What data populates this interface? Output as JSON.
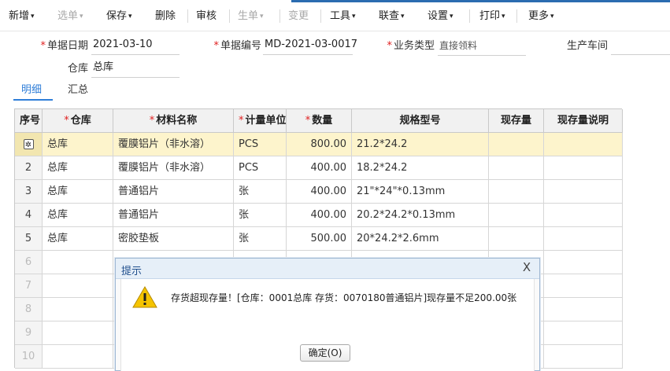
{
  "toolbar": {
    "items": [
      {
        "label": "新增",
        "caret": true,
        "disabled": false
      },
      {
        "label": "选单",
        "caret": true,
        "disabled": true
      },
      {
        "label": "保存",
        "caret": true,
        "disabled": false
      },
      {
        "label": "删除",
        "caret": false,
        "disabled": false
      },
      {
        "label": "审核",
        "caret": false,
        "disabled": false
      },
      {
        "label": "生单",
        "caret": true,
        "disabled": true
      },
      {
        "label": "变更",
        "caret": false,
        "disabled": true
      },
      {
        "label": "工具",
        "caret": true,
        "disabled": false
      },
      {
        "label": "联查",
        "caret": true,
        "disabled": false
      },
      {
        "label": "设置",
        "caret": true,
        "disabled": false
      },
      {
        "label": "打印",
        "caret": true,
        "disabled": false
      },
      {
        "label": "更多",
        "caret": true,
        "disabled": false
      }
    ],
    "caret_glyph": "▾"
  },
  "form": {
    "date_label": "单据日期",
    "date_value": "2021-03-10",
    "docno_label": "单据编号",
    "docno_value": "MD-2021-03-0017",
    "biztype_label": "业务类型",
    "biztype_value": "直接领料",
    "workshop_label": "生产车间",
    "workshop_value": "",
    "warehouse_label": "仓库",
    "warehouse_value": "总库"
  },
  "tabs": [
    {
      "label": "明细",
      "active": true
    },
    {
      "label": "汇总",
      "active": false
    }
  ],
  "grid": {
    "headers": [
      {
        "label": "序号",
        "required": false
      },
      {
        "label": "仓库",
        "required": true
      },
      {
        "label": "材料名称",
        "required": true
      },
      {
        "label": "计量单位",
        "required": true
      },
      {
        "label": "数量",
        "required": true
      },
      {
        "label": "规格型号",
        "required": false
      },
      {
        "label": "现存量",
        "required": false
      },
      {
        "label": "现存量说明",
        "required": false
      }
    ],
    "rows": [
      {
        "no": "",
        "warehouse": "总库",
        "material": "覆膜铝片（非水溶）",
        "unit": "PCS",
        "qty": "800.00",
        "spec": "21.2*24.2",
        "stock": "",
        "stock_note": "",
        "selected": true
      },
      {
        "no": "2",
        "warehouse": "总库",
        "material": "覆膜铝片（非水溶）",
        "unit": "PCS",
        "qty": "400.00",
        "spec": "18.2*24.2",
        "stock": "",
        "stock_note": "",
        "selected": false
      },
      {
        "no": "3",
        "warehouse": "总库",
        "material": "普通铝片",
        "unit": "张",
        "qty": "400.00",
        "spec": "21\"*24\"*0.13mm",
        "stock": "",
        "stock_note": "",
        "selected": false
      },
      {
        "no": "4",
        "warehouse": "总库",
        "material": "普通铝片",
        "unit": "张",
        "qty": "400.00",
        "spec": "20.2*24.2*0.13mm",
        "stock": "",
        "stock_note": "",
        "selected": false
      },
      {
        "no": "5",
        "warehouse": "总库",
        "material": "密胶垫板",
        "unit": "张",
        "qty": "500.00",
        "spec": "20*24.2*2.6mm",
        "stock": "",
        "stock_note": "",
        "selected": false
      },
      {
        "no": "6",
        "warehouse": "",
        "material": "",
        "unit": "",
        "qty": "",
        "spec": "",
        "stock": "",
        "stock_note": "",
        "selected": false
      },
      {
        "no": "7",
        "warehouse": "",
        "material": "",
        "unit": "",
        "qty": "",
        "spec": "",
        "stock": "",
        "stock_note": "",
        "selected": false
      },
      {
        "no": "8",
        "warehouse": "",
        "material": "",
        "unit": "",
        "qty": "",
        "spec": "",
        "stock": "",
        "stock_note": "",
        "selected": false
      },
      {
        "no": "9",
        "warehouse": "",
        "material": "",
        "unit": "",
        "qty": "",
        "spec": "",
        "stock": "",
        "stock_note": "",
        "selected": false
      },
      {
        "no": "10",
        "warehouse": "",
        "material": "",
        "unit": "",
        "qty": "",
        "spec": "",
        "stock": "",
        "stock_note": "",
        "selected": false
      }
    ],
    "row_settings_icon": "gear-icon"
  },
  "dialog": {
    "title": "提示",
    "close_glyph": "X",
    "message": "存货超现存量！[仓库：0001总库 存货：0070180普通铝片]现存量不足200.00张",
    "icon": "warning-triangle-icon",
    "ok_label": "确定(O)"
  },
  "colors": {
    "accent": "#2f7ed8",
    "required": "#e02020",
    "selected_row": "#fdf4cc",
    "warning": "#f5c400"
  }
}
